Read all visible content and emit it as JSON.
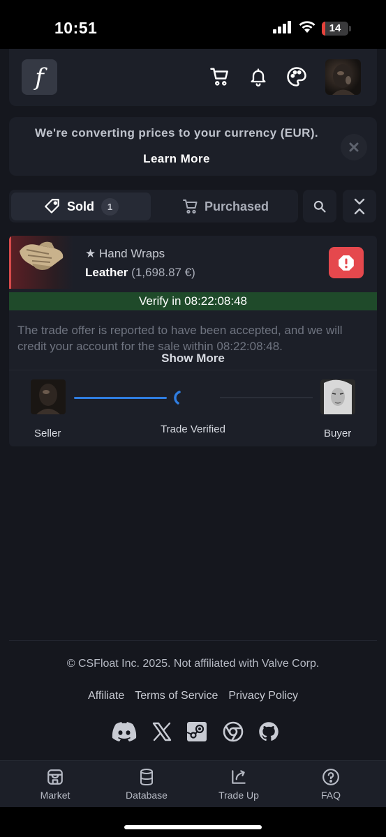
{
  "status_bar": {
    "time": "10:51",
    "battery": "14"
  },
  "header": {
    "logo_glyph": "f",
    "icons": [
      "cart-icon",
      "bell-icon",
      "palette-icon"
    ]
  },
  "banner": {
    "message": "We're converting prices to your currency (EUR).",
    "link": "Learn More"
  },
  "tabs": {
    "sold_label": "Sold",
    "sold_count": "1",
    "purchased_label": "Purchased"
  },
  "trade": {
    "star": "★",
    "item_name": "Hand Wraps",
    "wear": "Leather",
    "price": "(1,698.87 €)",
    "verify_text": "Verify in 08:22:08:48",
    "message": "The trade offer is reported to have been accepted, and we will credit your account for the sale within 08:22:08:48.",
    "show_more": "Show More",
    "seller_label": "Seller",
    "status_label": "Trade Verified",
    "buyer_label": "Buyer"
  },
  "footer": {
    "copyright": "© CSFloat Inc. 2025. Not affiliated with Valve Corp.",
    "links": [
      "Affiliate",
      "Terms of Service",
      "Privacy Policy"
    ],
    "social_icons": [
      "discord-icon",
      "x-icon",
      "steam-icon",
      "chrome-icon",
      "github-icon"
    ]
  },
  "bottom_nav": {
    "items": [
      {
        "label": "Market",
        "icon": "store-icon"
      },
      {
        "label": "Database",
        "icon": "database-icon"
      },
      {
        "label": "Trade Up",
        "icon": "trade-up-icon"
      },
      {
        "label": "FAQ",
        "icon": "help-icon"
      }
    ]
  },
  "colors": {
    "background": "#15171e",
    "card": "#1c1f28",
    "alert": "#e5484d",
    "verify": "#1f4a2a",
    "progress": "#2f7de1"
  }
}
